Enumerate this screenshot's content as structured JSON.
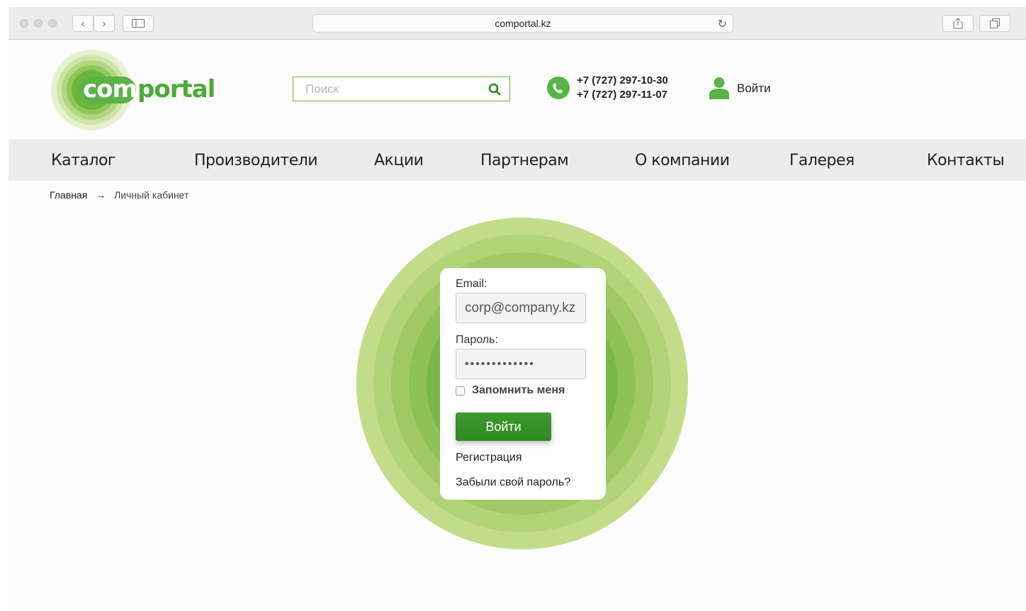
{
  "browser": {
    "url": "comportal.kz"
  },
  "header": {
    "logo_text": "comportal",
    "search_placeholder": "Поиск",
    "phones": [
      "+7 (727) 297-10-30",
      "+7 (727) 297-11-07"
    ],
    "login_label": "Войти"
  },
  "nav": {
    "items": [
      "Каталог",
      "Производители",
      "Акции",
      "Партнерам",
      "О компании",
      "Галерея",
      "Контакты"
    ]
  },
  "breadcrumb": {
    "home": "Главная",
    "separator": "→",
    "current": "Личный кабинет"
  },
  "login_form": {
    "email_label": "Email:",
    "email_value": "corp@company.kz",
    "password_label": "Пароль:",
    "password_value": "•••••••••••••",
    "remember_label": "Запомнить меня",
    "submit_label": "Войти",
    "register_link": "Регистрация",
    "forgot_link": "Забыли свой пароль?"
  },
  "colors": {
    "brand_green": "#59b346",
    "button_green": "#3d9a2e",
    "ring_outer": "#c3dc8a",
    "ring_inner": "#4aaa3a"
  }
}
